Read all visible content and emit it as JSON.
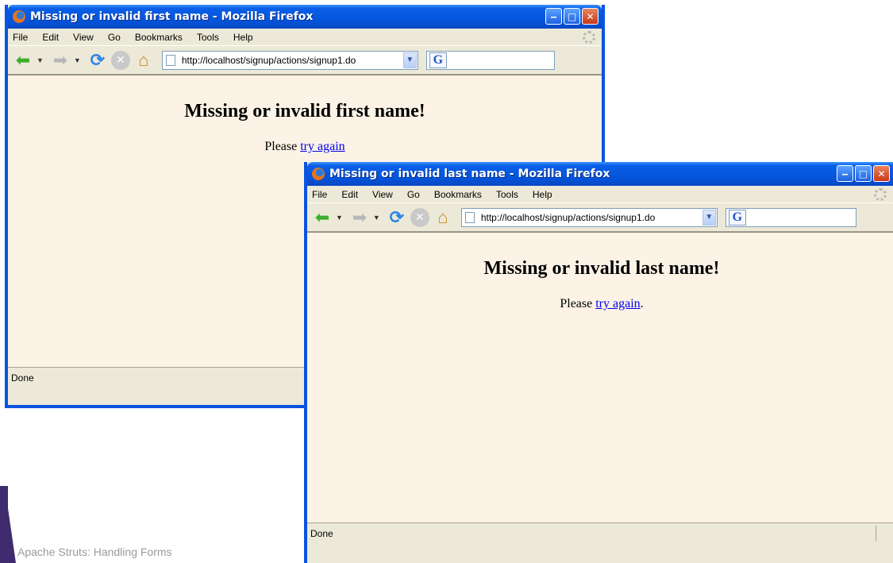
{
  "slide": {
    "footer": "Apache Struts: Handling Forms"
  },
  "window1": {
    "title": "Missing or invalid first name - Mozilla Firefox",
    "menu": [
      "File",
      "Edit",
      "View",
      "Go",
      "Bookmarks",
      "Tools",
      "Help"
    ],
    "url": "http://localhost/signup/actions/signup1.do",
    "heading": "Missing or invalid first name!",
    "please": "Please ",
    "link": "try again",
    "status": "Done"
  },
  "window2": {
    "title": "Missing or invalid last name - Mozilla Firefox",
    "menu": [
      "File",
      "Edit",
      "View",
      "Go",
      "Bookmarks",
      "Tools",
      "Help"
    ],
    "url": "http://localhost/signup/actions/signup1.do",
    "heading": "Missing or invalid last name!",
    "please": "Please ",
    "link": "try again",
    "period": ".",
    "status": "Done"
  },
  "icons": {
    "app": "firefox-icon",
    "back": "back-arrow-icon",
    "forward": "forward-arrow-icon",
    "reload": "reload-icon",
    "stop": "stop-icon",
    "home": "home-icon",
    "search_engine": "google-icon"
  }
}
